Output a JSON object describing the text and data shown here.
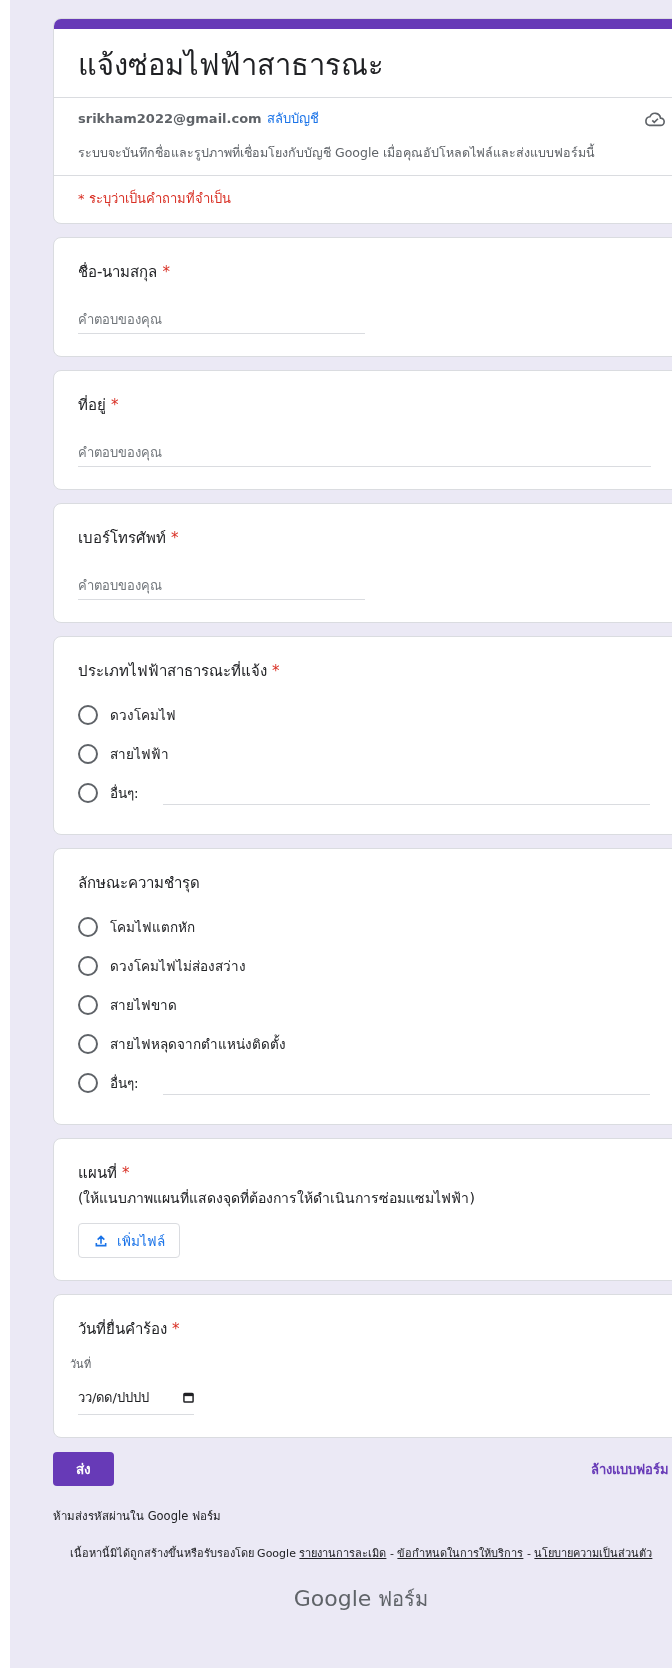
{
  "header": {
    "title": "แจ้งซ่อมไฟฟ้าสาธารณะ",
    "account": "srikham2022@gmail.com",
    "switch_link": "สลับบัญชี",
    "note": "ระบบจะบันทึกชื่อและรูปภาพที่เชื่อมโยงกับบัญชี Google เมื่อคุณอัปโหลดไฟล์และส่งแบบฟอร์มนี้",
    "required_note": "* ระบุว่าเป็นคำถามที่จำเป็น"
  },
  "required_mark": "*",
  "questions": [
    {
      "kind": "short_text",
      "title": "ชื่อ-นามสกุล",
      "required": true,
      "placeholder": "คำตอบของคุณ"
    },
    {
      "kind": "long_text",
      "title": "ที่อยู่",
      "required": true,
      "placeholder": "คำตอบของคุณ"
    },
    {
      "kind": "short_text",
      "title": "เบอร์โทรศัพท์",
      "required": true,
      "placeholder": "คำตอบของคุณ"
    },
    {
      "kind": "radio",
      "title": "ประเภทไฟฟ้าสาธารณะที่แจ้ง",
      "required": true,
      "options": [
        {
          "kind": "option",
          "label": "ดวงโคมไฟ",
          "selected": false
        },
        {
          "kind": "option",
          "label": "สายไฟฟ้า",
          "selected": false
        },
        {
          "kind": "other",
          "label": "อื่นๆ:",
          "selected": false
        }
      ]
    },
    {
      "kind": "radio",
      "title": "ลักษณะความชำรุด",
      "required": false,
      "options": [
        {
          "kind": "option",
          "label": "โคมไฟแตกหัก",
          "selected": false
        },
        {
          "kind": "option",
          "label": "ดวงโคมไฟไม่ส่องสว่าง",
          "selected": false
        },
        {
          "kind": "option",
          "label": "สายไฟขาด",
          "selected": false
        },
        {
          "kind": "option",
          "label": "สายไฟหลุดจากตำแหน่งติดตั้ง",
          "selected": false
        },
        {
          "kind": "other",
          "label": "อื่นๆ:",
          "selected": false
        }
      ]
    },
    {
      "kind": "file",
      "title": "แผนที่",
      "required": true,
      "description": "(ให้แนบภาพแผนที่แสดงจุดที่ต้องการให้ดำเนินการซ่อมแซมไฟฟ้า)",
      "button": "เพิ่มไฟล์"
    },
    {
      "kind": "date",
      "title": "วันที่ยื่นคำร้อง",
      "required": true,
      "sublabel": "วันที่",
      "placeholder": "วว/ดด/ปปปป"
    }
  ],
  "actions": {
    "submit": "ส่ง",
    "clear": "ล้างแบบฟอร์ม"
  },
  "footer": {
    "warning": "ห้ามส่งรหัสผ่านใน Google ฟอร์ม",
    "disclaimer": [
      {
        "kind": "text",
        "text": "เนื้อหานี้มิได้ถูกสร้างขึ้นหรือรับรองโดย Google"
      },
      {
        "kind": "link",
        "text": "รายงานการละเมิด"
      },
      {
        "kind": "text",
        "text": "-"
      },
      {
        "kind": "link",
        "text": "ข้อกำหนดในการให้บริการ"
      },
      {
        "kind": "text",
        "text": "-"
      },
      {
        "kind": "link",
        "text": "นโยบายความเป็นส่วนตัว"
      }
    ],
    "logo": {
      "brand": "Google",
      "product": "ฟอร์ม"
    }
  }
}
